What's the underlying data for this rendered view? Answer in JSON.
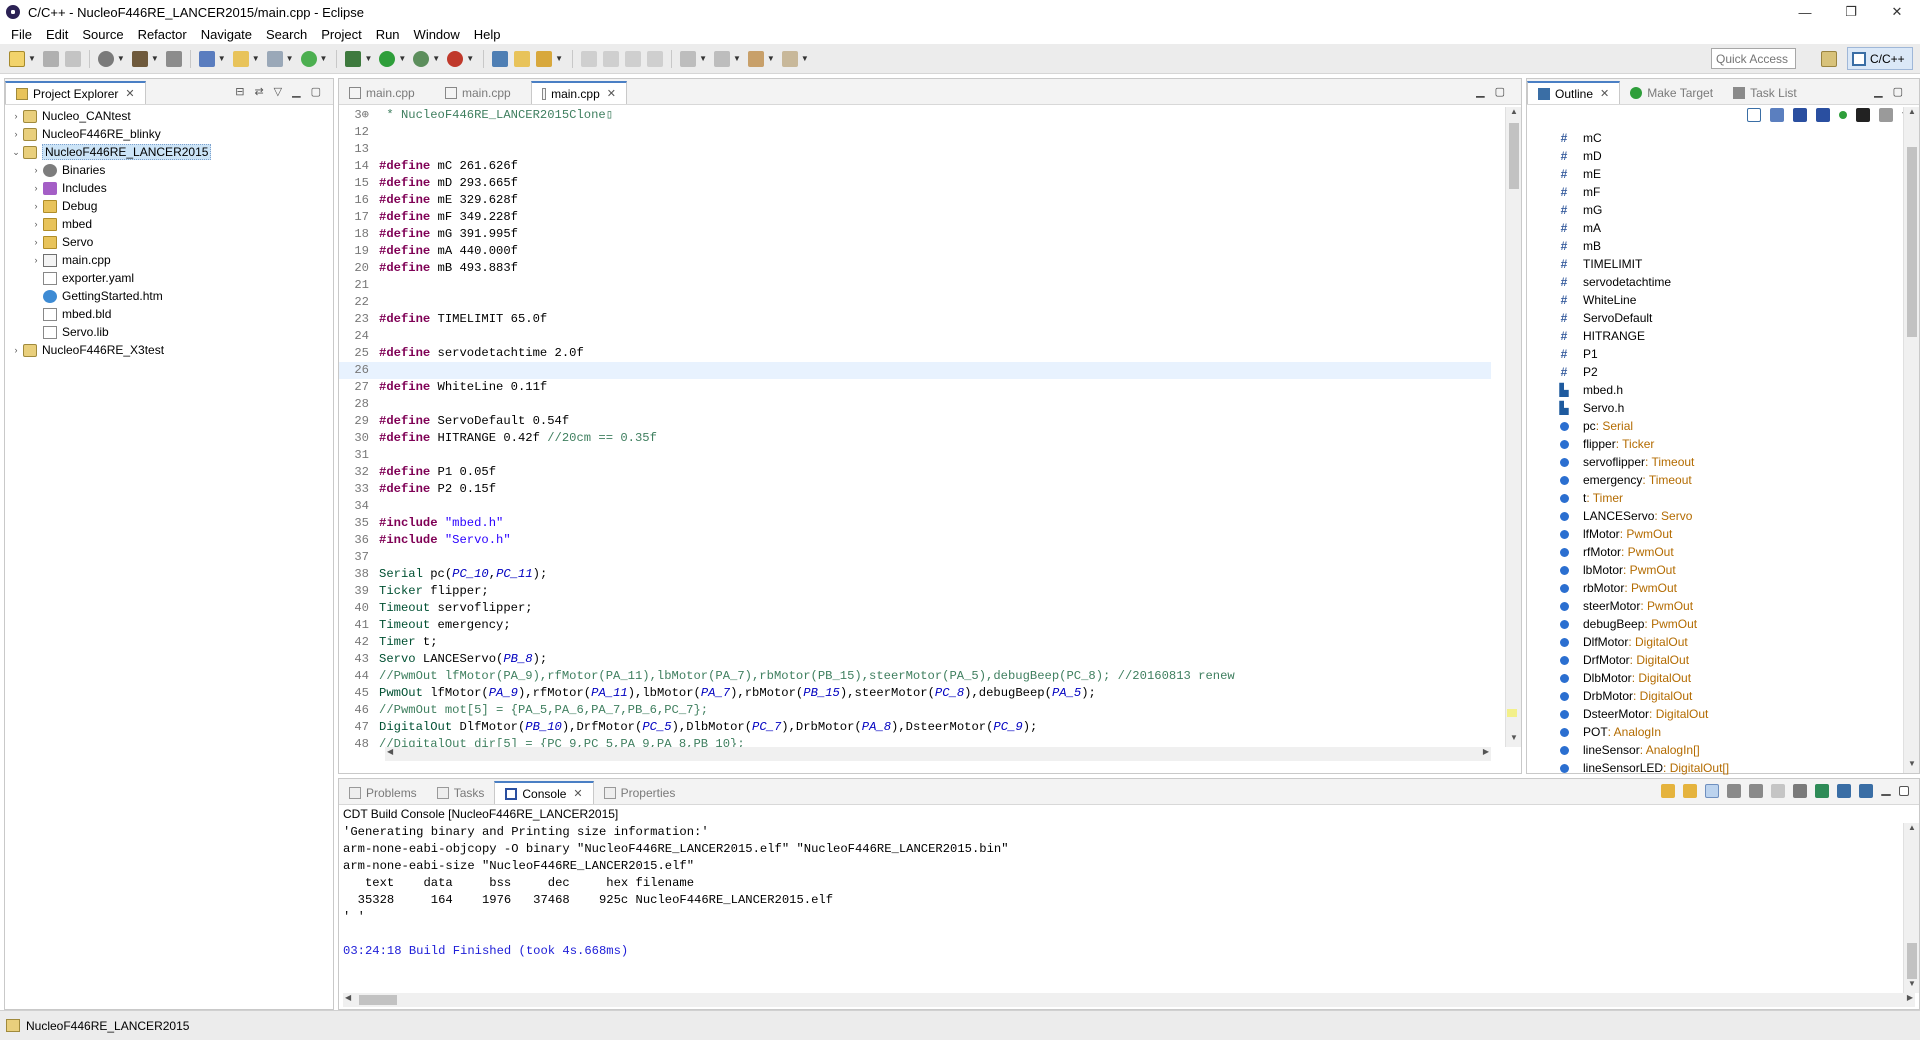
{
  "window": {
    "title": "C/C++ - NucleoF446RE_LANCER2015/main.cpp - Eclipse",
    "controls": [
      "—",
      "❐",
      "✕"
    ]
  },
  "menu": [
    "File",
    "Edit",
    "Source",
    "Refactor",
    "Navigate",
    "Search",
    "Project",
    "Run",
    "Window",
    "Help"
  ],
  "toolbar": {
    "quick_access_placeholder": "Quick Access",
    "perspective": "C/C++"
  },
  "explorer": {
    "tab": "Project Explorer",
    "items": [
      {
        "label": "Nucleo_CANtest",
        "level": 0,
        "twist": "›",
        "icon": "project-icon"
      },
      {
        "label": "NucleoF446RE_blinky",
        "level": 0,
        "twist": "›",
        "icon": "project-icon"
      },
      {
        "label": "NucleoF446RE_LANCER2015",
        "level": 0,
        "twist": "⌄",
        "icon": "project-icon",
        "selected": true
      },
      {
        "label": "Binaries",
        "level": 1,
        "twist": "›",
        "icon": "binaries-icon"
      },
      {
        "label": "Includes",
        "level": 1,
        "twist": "›",
        "icon": "includes-icon"
      },
      {
        "label": "Debug",
        "level": 1,
        "twist": "›",
        "icon": "folder-icon"
      },
      {
        "label": "mbed",
        "level": 1,
        "twist": "›",
        "icon": "folder-icon"
      },
      {
        "label": "Servo",
        "level": 1,
        "twist": "›",
        "icon": "folder-icon"
      },
      {
        "label": "main.cpp",
        "level": 1,
        "twist": "›",
        "icon": "cpp-file-icon"
      },
      {
        "label": "exporter.yaml",
        "level": 1,
        "twist": "",
        "icon": "file-icon"
      },
      {
        "label": "GettingStarted.htm",
        "level": 1,
        "twist": "",
        "icon": "html-file-icon"
      },
      {
        "label": "mbed.bld",
        "level": 1,
        "twist": "",
        "icon": "file-icon"
      },
      {
        "label": "Servo.lib",
        "level": 1,
        "twist": "",
        "icon": "file-icon"
      },
      {
        "label": "NucleoF446RE_X3test",
        "level": 0,
        "twist": "›",
        "icon": "project-icon"
      }
    ]
  },
  "editor": {
    "tabs": [
      {
        "label": "main.cpp",
        "active": false
      },
      {
        "label": "main.cpp",
        "active": false
      },
      {
        "label": "main.cpp",
        "active": true
      }
    ],
    "current_line": "26",
    "lines": [
      {
        "n": "3⊕",
        "parts": [
          {
            "c": "cm",
            "t": " * NucleoF446RE_LANCER2015Clone▯"
          }
        ]
      },
      {
        "n": "12",
        "parts": []
      },
      {
        "n": "13",
        "parts": []
      },
      {
        "n": "14",
        "parts": [
          {
            "c": "kw",
            "t": "#define"
          },
          {
            "c": "",
            "t": " mC 261.626f"
          }
        ]
      },
      {
        "n": "15",
        "parts": [
          {
            "c": "kw",
            "t": "#define"
          },
          {
            "c": "",
            "t": " mD 293.665f"
          }
        ]
      },
      {
        "n": "16",
        "parts": [
          {
            "c": "kw",
            "t": "#define"
          },
          {
            "c": "",
            "t": " mE 329.628f"
          }
        ]
      },
      {
        "n": "17",
        "parts": [
          {
            "c": "kw",
            "t": "#define"
          },
          {
            "c": "",
            "t": " mF 349.228f"
          }
        ]
      },
      {
        "n": "18",
        "parts": [
          {
            "c": "kw",
            "t": "#define"
          },
          {
            "c": "",
            "t": " mG 391.995f"
          }
        ]
      },
      {
        "n": "19",
        "parts": [
          {
            "c": "kw",
            "t": "#define"
          },
          {
            "c": "",
            "t": " mA 440.000f"
          }
        ]
      },
      {
        "n": "20",
        "parts": [
          {
            "c": "kw",
            "t": "#define"
          },
          {
            "c": "",
            "t": " mB 493.883f"
          }
        ]
      },
      {
        "n": "21",
        "parts": []
      },
      {
        "n": "22",
        "parts": []
      },
      {
        "n": "23",
        "parts": [
          {
            "c": "kw",
            "t": "#define"
          },
          {
            "c": "",
            "t": " TIMELIMIT 65.0f"
          }
        ]
      },
      {
        "n": "24",
        "parts": []
      },
      {
        "n": "25",
        "parts": [
          {
            "c": "kw",
            "t": "#define"
          },
          {
            "c": "",
            "t": " servodetachtime 2.0f"
          }
        ]
      },
      {
        "n": "26",
        "parts": []
      },
      {
        "n": "27",
        "parts": [
          {
            "c": "kw",
            "t": "#define"
          },
          {
            "c": "",
            "t": " WhiteLine 0.11f"
          }
        ]
      },
      {
        "n": "28",
        "parts": []
      },
      {
        "n": "29",
        "parts": [
          {
            "c": "kw",
            "t": "#define"
          },
          {
            "c": "",
            "t": " ServoDefault 0.54f"
          }
        ]
      },
      {
        "n": "30",
        "parts": [
          {
            "c": "kw",
            "t": "#define"
          },
          {
            "c": "",
            "t": " HITRANGE 0.42f "
          },
          {
            "c": "cm",
            "t": "//20cm == 0.35f"
          }
        ]
      },
      {
        "n": "31",
        "parts": []
      },
      {
        "n": "32",
        "parts": [
          {
            "c": "kw",
            "t": "#define"
          },
          {
            "c": "",
            "t": " P1 0.05f"
          }
        ]
      },
      {
        "n": "33",
        "parts": [
          {
            "c": "kw",
            "t": "#define"
          },
          {
            "c": "",
            "t": " P2 0.15f"
          }
        ]
      },
      {
        "n": "34",
        "parts": []
      },
      {
        "n": "35",
        "parts": [
          {
            "c": "kw",
            "t": "#include"
          },
          {
            "c": "",
            "t": " "
          },
          {
            "c": "str",
            "t": "\"mbed.h\""
          }
        ]
      },
      {
        "n": "36",
        "parts": [
          {
            "c": "kw",
            "t": "#include"
          },
          {
            "c": "",
            "t": " "
          },
          {
            "c": "str",
            "t": "\"Servo.h\""
          }
        ]
      },
      {
        "n": "37",
        "parts": []
      },
      {
        "n": "38",
        "parts": [
          {
            "c": "ty",
            "t": "Serial"
          },
          {
            "c": "",
            "t": " pc("
          },
          {
            "c": "pin",
            "t": "PC_10"
          },
          {
            "c": "",
            "t": ","
          },
          {
            "c": "pin",
            "t": "PC_11"
          },
          {
            "c": "",
            "t": ");"
          }
        ]
      },
      {
        "n": "39",
        "parts": [
          {
            "c": "ty",
            "t": "Ticker"
          },
          {
            "c": "",
            "t": " flipper;"
          }
        ]
      },
      {
        "n": "40",
        "parts": [
          {
            "c": "ty",
            "t": "Timeout"
          },
          {
            "c": "",
            "t": " servoflipper;"
          }
        ]
      },
      {
        "n": "41",
        "parts": [
          {
            "c": "ty",
            "t": "Timeout"
          },
          {
            "c": "",
            "t": " emergency;"
          }
        ]
      },
      {
        "n": "42",
        "parts": [
          {
            "c": "ty",
            "t": "Timer"
          },
          {
            "c": "",
            "t": " t;"
          }
        ]
      },
      {
        "n": "43",
        "parts": [
          {
            "c": "ty",
            "t": "Servo"
          },
          {
            "c": "",
            "t": " LANCEServo("
          },
          {
            "c": "pin",
            "t": "PB_8"
          },
          {
            "c": "",
            "t": ");"
          }
        ]
      },
      {
        "n": "44",
        "parts": [
          {
            "c": "cm",
            "t": "//PwmOut lfMotor(PA_9),rfMotor(PA_11),lbMotor(PA_7),rbMotor(PB_15),steerMotor(PA_5),debugBeep(PC_8); //20160813 renew"
          }
        ]
      },
      {
        "n": "45",
        "parts": [
          {
            "c": "ty",
            "t": "PwmOut"
          },
          {
            "c": "",
            "t": " lfMotor("
          },
          {
            "c": "pin",
            "t": "PA_9"
          },
          {
            "c": "",
            "t": "),rfMotor("
          },
          {
            "c": "pin",
            "t": "PA_11"
          },
          {
            "c": "",
            "t": "),lbMotor("
          },
          {
            "c": "pin",
            "t": "PA_7"
          },
          {
            "c": "",
            "t": "),rbMotor("
          },
          {
            "c": "pin",
            "t": "PB_15"
          },
          {
            "c": "",
            "t": "),steerMotor("
          },
          {
            "c": "pin",
            "t": "PC_8"
          },
          {
            "c": "",
            "t": "),debugBeep("
          },
          {
            "c": "pin",
            "t": "PA_5"
          },
          {
            "c": "",
            "t": ");"
          }
        ]
      },
      {
        "n": "46",
        "parts": [
          {
            "c": "cm",
            "t": "//PwmOut mot[5] = {PA_5,PA_6,PA_7,PB_6,PC_7};"
          }
        ]
      },
      {
        "n": "47",
        "parts": [
          {
            "c": "ty",
            "t": "DigitalOut"
          },
          {
            "c": "",
            "t": " DlfMotor("
          },
          {
            "c": "pin",
            "t": "PB_10"
          },
          {
            "c": "",
            "t": "),DrfMotor("
          },
          {
            "c": "pin",
            "t": "PC_5"
          },
          {
            "c": "",
            "t": "),DlbMotor("
          },
          {
            "c": "pin",
            "t": "PC_7"
          },
          {
            "c": "",
            "t": "),DrbMotor("
          },
          {
            "c": "pin",
            "t": "PA_8"
          },
          {
            "c": "",
            "t": "),DsteerMotor("
          },
          {
            "c": "pin",
            "t": "PC_9"
          },
          {
            "c": "",
            "t": ");"
          }
        ]
      },
      {
        "n": "48",
        "parts": [
          {
            "c": "cm",
            "t": "//DigitalOut dir[5] = {PC_9,PC_5,PA_9,PA_8,PB_10};"
          }
        ]
      }
    ]
  },
  "outline": {
    "tabs": [
      {
        "label": "Outline",
        "active": true
      },
      {
        "label": "Make Target",
        "active": false
      },
      {
        "label": "Task List",
        "active": false
      }
    ],
    "items": [
      {
        "kind": "macro",
        "name": "mC",
        "type": ""
      },
      {
        "kind": "macro",
        "name": "mD",
        "type": ""
      },
      {
        "kind": "macro",
        "name": "mE",
        "type": ""
      },
      {
        "kind": "macro",
        "name": "mF",
        "type": ""
      },
      {
        "kind": "macro",
        "name": "mG",
        "type": ""
      },
      {
        "kind": "macro",
        "name": "mA",
        "type": ""
      },
      {
        "kind": "macro",
        "name": "mB",
        "type": ""
      },
      {
        "kind": "macro",
        "name": "TIMELIMIT",
        "type": ""
      },
      {
        "kind": "macro",
        "name": "servodetachtime",
        "type": ""
      },
      {
        "kind": "macro",
        "name": "WhiteLine",
        "type": ""
      },
      {
        "kind": "macro",
        "name": "ServoDefault",
        "type": ""
      },
      {
        "kind": "macro",
        "name": "HITRANGE",
        "type": ""
      },
      {
        "kind": "macro",
        "name": "P1",
        "type": ""
      },
      {
        "kind": "macro",
        "name": "P2",
        "type": ""
      },
      {
        "kind": "include",
        "name": "mbed.h",
        "type": ""
      },
      {
        "kind": "include",
        "name": "Servo.h",
        "type": ""
      },
      {
        "kind": "var",
        "name": "pc",
        "type": " : Serial"
      },
      {
        "kind": "var",
        "name": "flipper",
        "type": " : Ticker"
      },
      {
        "kind": "var",
        "name": "servoflipper",
        "type": " : Timeout"
      },
      {
        "kind": "var",
        "name": "emergency",
        "type": " : Timeout"
      },
      {
        "kind": "var",
        "name": "t",
        "type": " : Timer"
      },
      {
        "kind": "var",
        "name": "LANCEServo",
        "type": " : Servo"
      },
      {
        "kind": "var",
        "name": "lfMotor",
        "type": " : PwmOut"
      },
      {
        "kind": "var",
        "name": "rfMotor",
        "type": " : PwmOut"
      },
      {
        "kind": "var",
        "name": "lbMotor",
        "type": " : PwmOut"
      },
      {
        "kind": "var",
        "name": "rbMotor",
        "type": " : PwmOut"
      },
      {
        "kind": "var",
        "name": "steerMotor",
        "type": " : PwmOut"
      },
      {
        "kind": "var",
        "name": "debugBeep",
        "type": " : PwmOut"
      },
      {
        "kind": "var",
        "name": "DlfMotor",
        "type": " : DigitalOut"
      },
      {
        "kind": "var",
        "name": "DrfMotor",
        "type": " : DigitalOut"
      },
      {
        "kind": "var",
        "name": "DlbMotor",
        "type": " : DigitalOut"
      },
      {
        "kind": "var",
        "name": "DrbMotor",
        "type": " : DigitalOut"
      },
      {
        "kind": "var",
        "name": "DsteerMotor",
        "type": " : DigitalOut"
      },
      {
        "kind": "var",
        "name": "POT",
        "type": " : AnalogIn"
      },
      {
        "kind": "var",
        "name": "lineSensor",
        "type": " : AnalogIn[]"
      },
      {
        "kind": "var",
        "name": "lineSensorLED",
        "type": " : DigitalOut[]"
      }
    ]
  },
  "console": {
    "tabs": [
      {
        "label": "Problems",
        "active": false
      },
      {
        "label": "Tasks",
        "active": false
      },
      {
        "label": "Console",
        "active": true
      },
      {
        "label": "Properties",
        "active": false
      }
    ],
    "title": "CDT Build Console [NucleoF446RE_LANCER2015]",
    "lines": [
      {
        "t": "'Generating binary and Printing size information:'",
        "blue": false
      },
      {
        "t": "arm-none-eabi-objcopy -O binary \"NucleoF446RE_LANCER2015.elf\" \"NucleoF446RE_LANCER2015.bin\"",
        "blue": false
      },
      {
        "t": "arm-none-eabi-size \"NucleoF446RE_LANCER2015.elf\"",
        "blue": false
      },
      {
        "t": "   text    data     bss     dec     hex filename",
        "blue": false
      },
      {
        "t": "  35328     164    1976   37468    925c NucleoF446RE_LANCER2015.elf",
        "blue": false
      },
      {
        "t": "' '",
        "blue": false
      },
      {
        "t": "",
        "blue": false
      },
      {
        "t": "03:24:18 Build Finished (took 4s.668ms)",
        "blue": true
      }
    ]
  },
  "status": {
    "text": "NucleoF446RE_LANCER2015"
  }
}
